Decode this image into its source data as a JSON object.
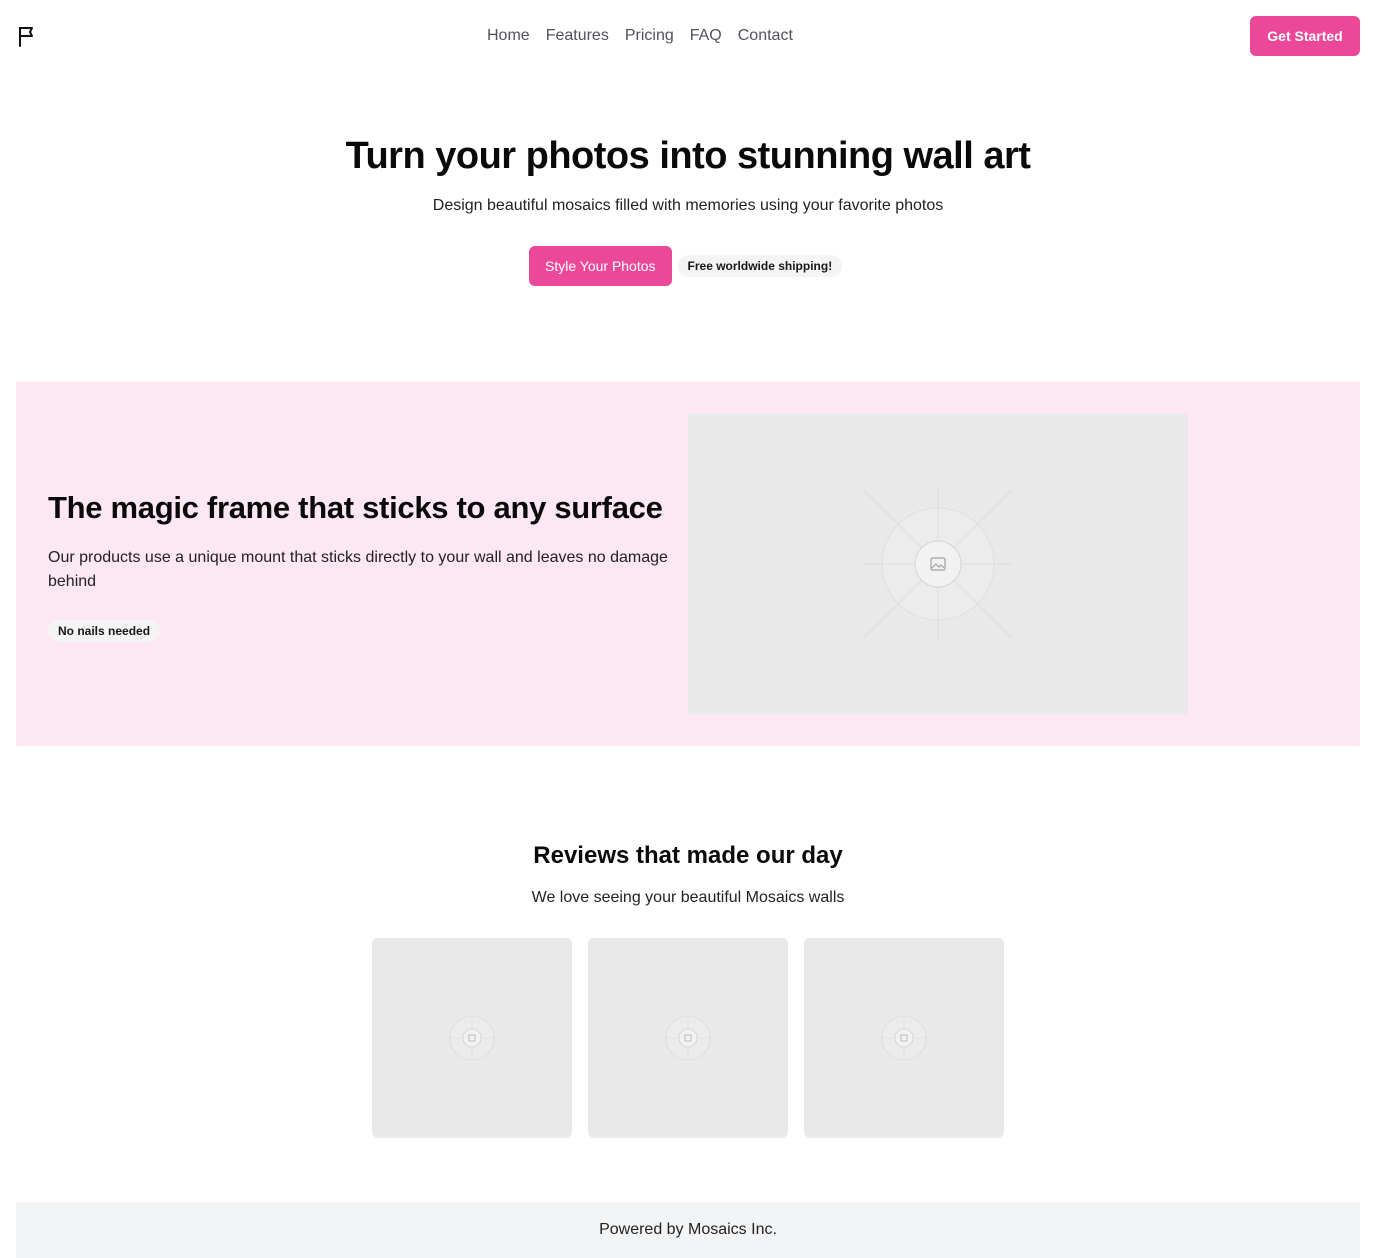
{
  "header": {
    "logo_icon": "flag-icon",
    "nav": [
      {
        "label": "Home"
      },
      {
        "label": "Features"
      },
      {
        "label": "Pricing"
      },
      {
        "label": "FAQ"
      },
      {
        "label": "Contact"
      }
    ],
    "cta_label": "Get Started"
  },
  "hero": {
    "title": "Turn your photos into stunning wall art",
    "subtitle": "Design beautiful mosaics filled with memories using your favorite photos",
    "primary_button": "Style Your Photos",
    "badge": "Free worldwide shipping!"
  },
  "feature": {
    "title": "The magic frame that sticks to any surface",
    "description": "Our products use a unique mount that sticks directly to your wall and leaves no damage behind",
    "badge": "No nails needed",
    "image_icon": "image-placeholder-icon"
  },
  "reviews": {
    "title": "Reviews that made our day",
    "subtitle": "We love seeing your beautiful Mosaics walls",
    "image_icon": "image-placeholder-icon"
  },
  "footer": {
    "text": "Powered by Mosaics Inc."
  },
  "colors": {
    "accent": "#ec4899",
    "feature_bg": "#fce7f3",
    "placeholder_bg": "#e9e9e9",
    "footer_bg": "#f3f4f6"
  }
}
